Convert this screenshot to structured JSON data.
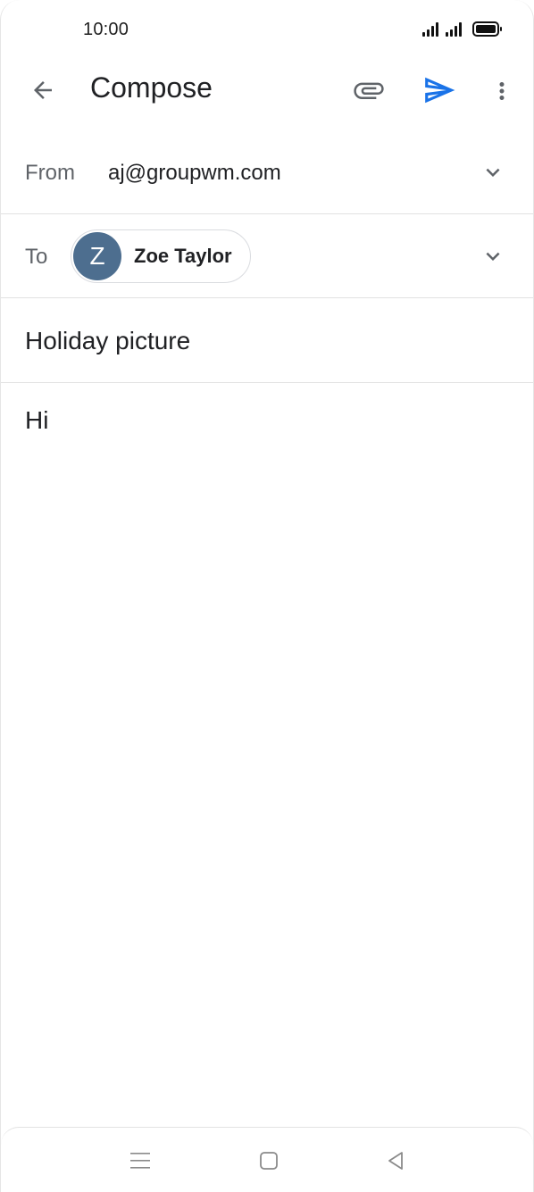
{
  "status_bar": {
    "time": "10:00",
    "icons": [
      "signal-icon",
      "signal-icon",
      "battery-icon"
    ]
  },
  "app_bar": {
    "title": "Compose",
    "icons": {
      "back": "arrow-back-icon",
      "attach": "paperclip-icon",
      "send": "send-icon",
      "more": "more-vert-icon"
    },
    "colors": {
      "send": "#1a73e8",
      "icon": "#5f6368"
    }
  },
  "compose": {
    "from_label": "From",
    "from_value": "aj@groupwm.com",
    "to_label": "To",
    "recipient": {
      "initial": "Z",
      "name": "Zoe Taylor",
      "avatar_color": "#4d6e8f"
    },
    "subject": "Holiday picture",
    "body": "Hi"
  },
  "nav_bar": {
    "icons": [
      "menu-icon",
      "home-icon",
      "back-icon"
    ]
  }
}
